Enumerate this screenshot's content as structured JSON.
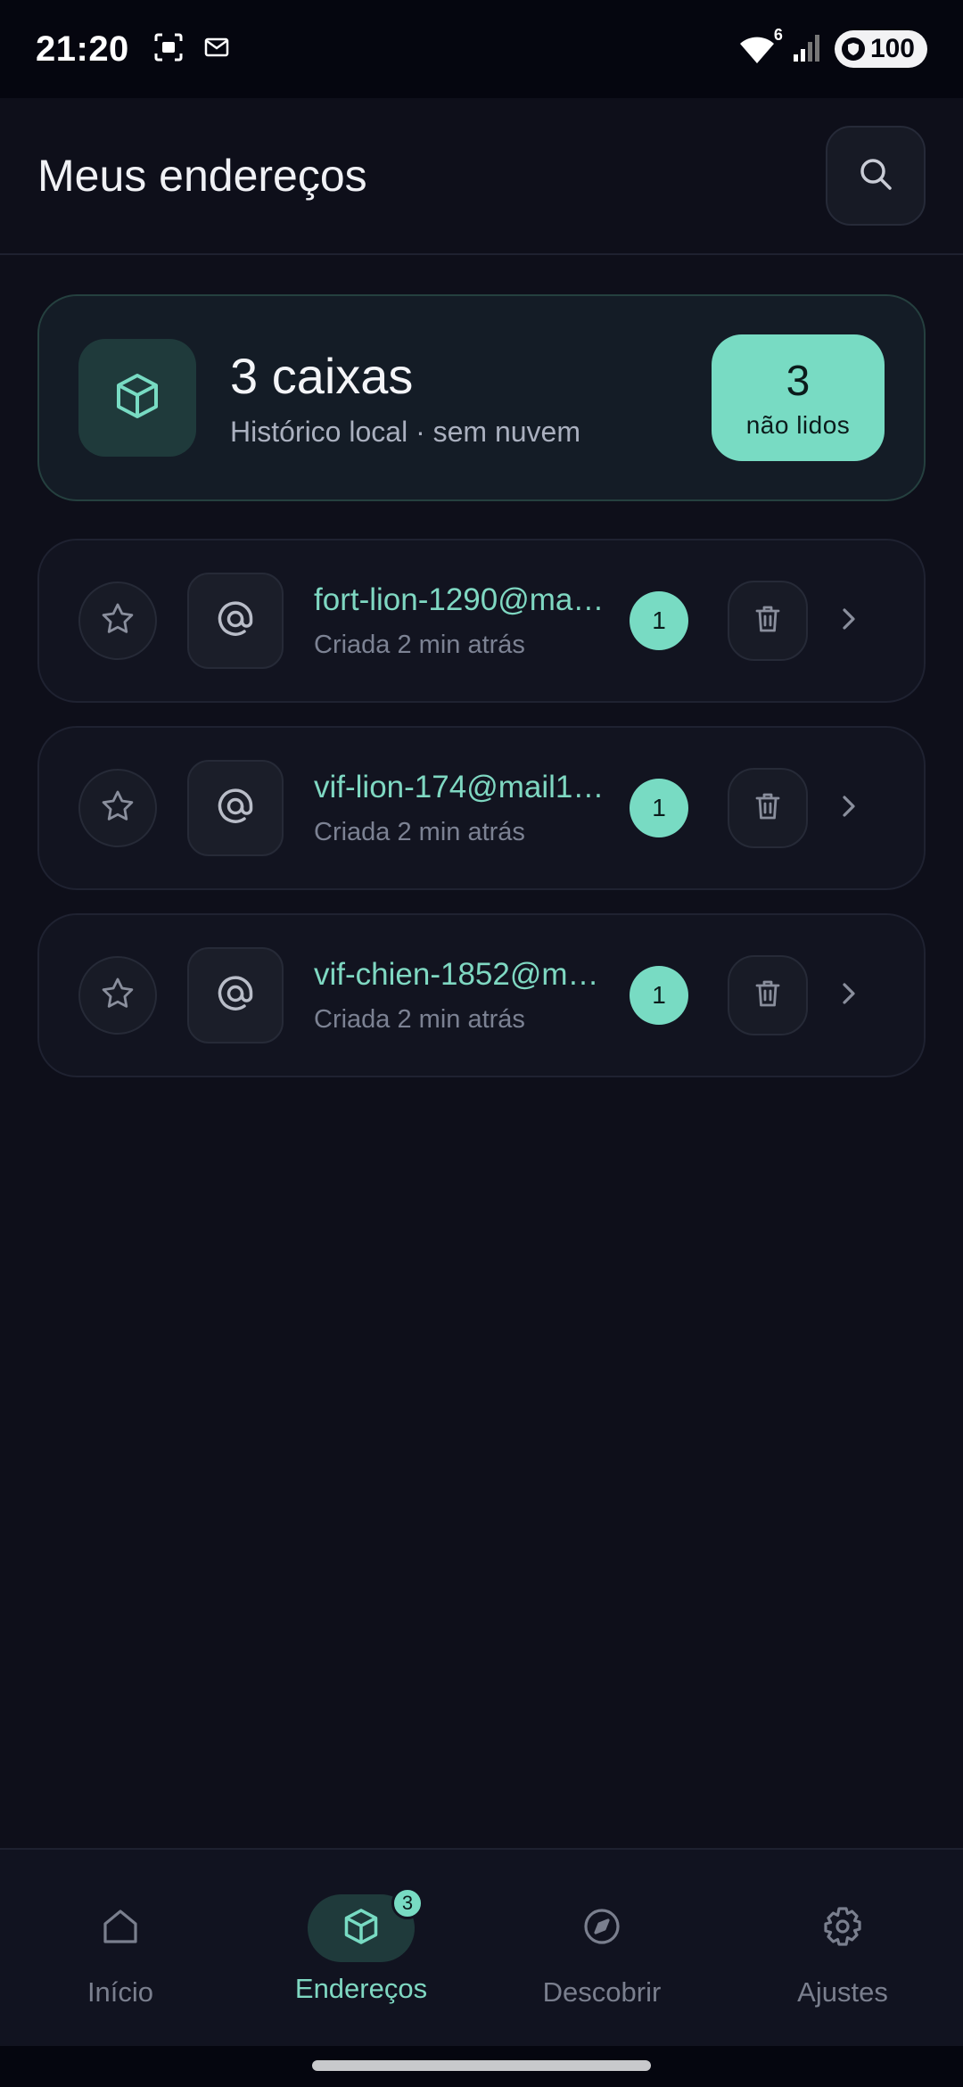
{
  "status_bar": {
    "time": "21:20",
    "battery": "100",
    "wifi_label": "6"
  },
  "header": {
    "title": "Meus endereços"
  },
  "summary": {
    "count_text": "3 caixas",
    "subtitle": "Histórico local · sem nuvem",
    "unread_count": "3",
    "unread_label": "não lidos"
  },
  "addresses": [
    {
      "email": "fort-lion-1290@ma…",
      "created": "Criada 2 min atrás",
      "count": "1"
    },
    {
      "email": "vif-lion-174@mail1…",
      "created": "Criada 2 min atrás",
      "count": "1"
    },
    {
      "email": "vif-chien-1852@m…",
      "created": "Criada 2 min atrás",
      "count": "1"
    }
  ],
  "nav": {
    "items": [
      {
        "label": "Início",
        "icon": "home-icon"
      },
      {
        "label": "Endereços",
        "icon": "box-icon",
        "badge": "3",
        "active": true
      },
      {
        "label": "Descobrir",
        "icon": "compass-icon"
      },
      {
        "label": "Ajustes",
        "icon": "gear-icon"
      }
    ]
  },
  "colors": {
    "accent": "#78dbc3",
    "background": "#0e0f1a",
    "accent_text": "#7fd8c2"
  }
}
